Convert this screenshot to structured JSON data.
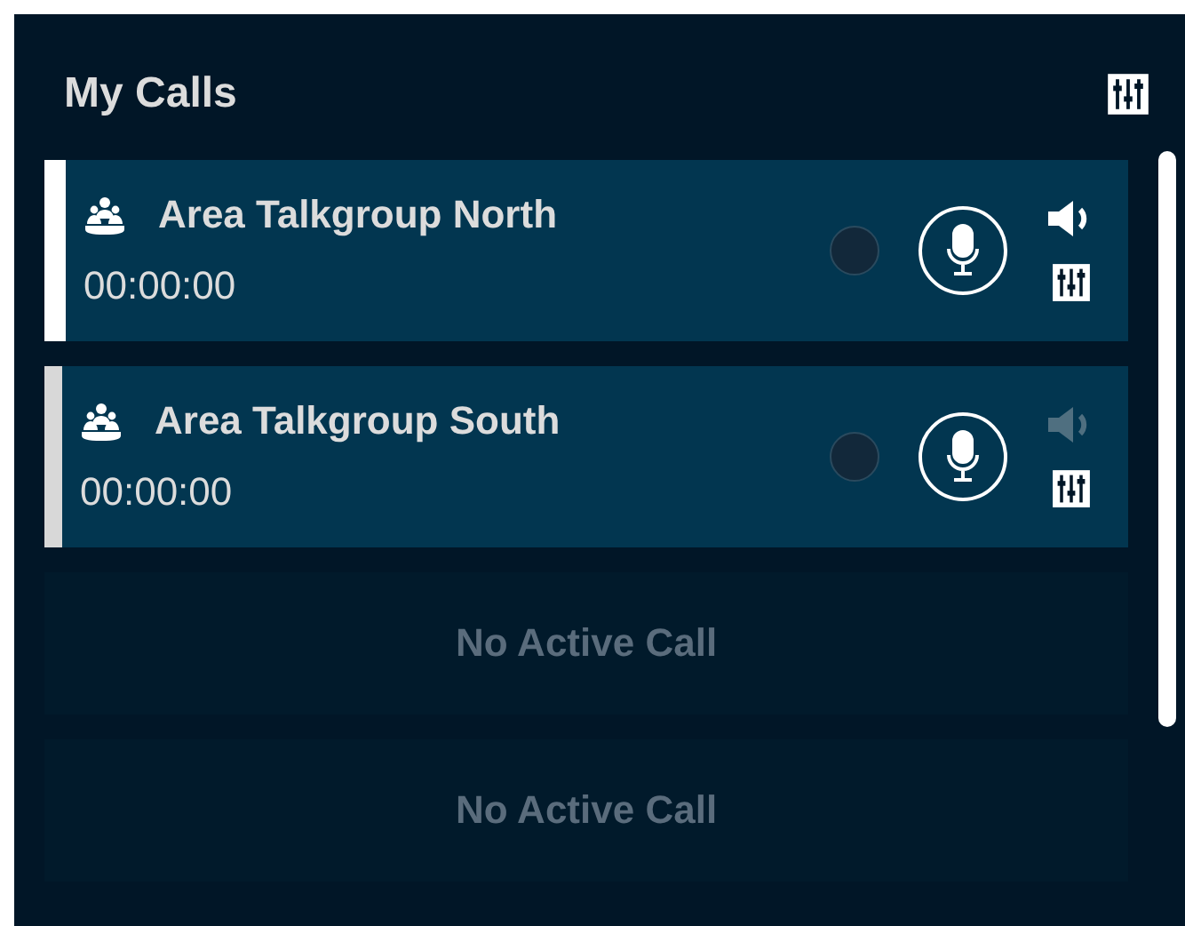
{
  "panel": {
    "title": "My Calls"
  },
  "calls": [
    {
      "kind": "active",
      "name": "Area Talkgroup North",
      "timer": "00:00:00",
      "selected": true,
      "speaker_on": true
    },
    {
      "kind": "active",
      "name": "Area Talkgroup South",
      "timer": "00:00:00",
      "selected": false,
      "speaker_on": false
    },
    {
      "kind": "empty",
      "label": "No Active Call"
    },
    {
      "kind": "empty",
      "label": "No Active Call"
    }
  ]
}
